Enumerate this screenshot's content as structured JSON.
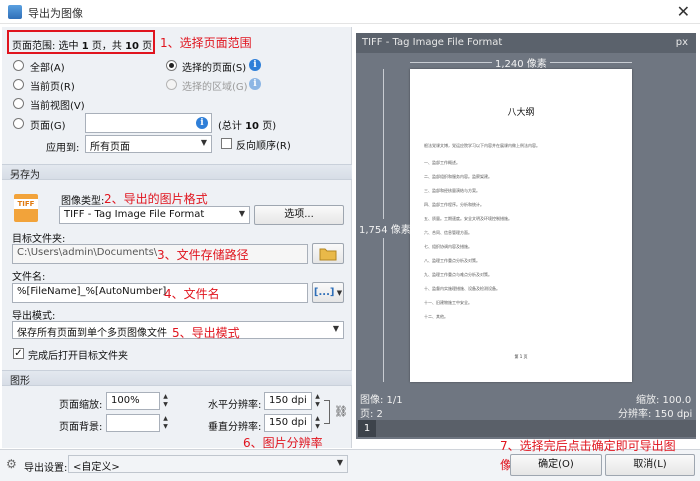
{
  "window": {
    "title": "导出为图像",
    "close": "✕"
  },
  "range": {
    "summary_prefix": "页面范围: 选中 ",
    "selected": "1",
    "mid": " 页，共 ",
    "total": "10",
    "suffix": " 页",
    "all": "全部(A)",
    "current": "当前页(R)",
    "current_view": "当前视图(V)",
    "pages": "页面(G)",
    "selected_pages": "选择的页面(S)",
    "selected_area": "选择的区域(G)",
    "pages_value": "",
    "total_prefix": "(总计 ",
    "total_count": "10",
    "total_suffix": " 页)",
    "apply_to_label": "应用到:",
    "apply_to_value": "所有页面",
    "reverse_order": "反向顺序(R)"
  },
  "save_as": {
    "section": "另存为",
    "tiff_icon_label": "TIFF",
    "image_type_label": "图像类型:",
    "image_type_value": "TIFF - Tag Image File Format",
    "options_button": "选项...",
    "target_folder_label": "目标文件夹:",
    "target_folder_value": "C:\\Users\\admin\\Documents\\",
    "filename_label": "文件名:",
    "filename_value": "%[FileName]_%[AutoNumber]",
    "filename_macro_button": "[...]",
    "export_mode_label": "导出模式:",
    "export_mode_value": "保存所有页面到单个多页图像文件",
    "open_folder_after": "完成后打开目标文件夹"
  },
  "graphics": {
    "section": "图形",
    "page_zoom_label": "页面缩放:",
    "page_zoom_value": "100%",
    "page_bg_label": "页面背景:",
    "h_res_label": "水平分辨率:",
    "h_res_value": "150 dpi",
    "v_res_label": "垂直分辨率:",
    "v_res_value": "150 dpi"
  },
  "preview": {
    "header": "TIFF - Tag Image File Format",
    "unit": "px",
    "width_label": "1,240 像素",
    "height_label": "1,754 像素",
    "doc_title": "八大纲",
    "doc_para": "根法党课文博，党运应院学习以下内容并在展课内做上例法内容。",
    "doc_items": [
      "一、监部工作概述。",
      "二、监部组织和服务内容。监察架建。",
      "三、监部和经核量演结与方案。",
      "四、监部工作程序。分析和统计。",
      "五、质量。工期速度。安全文明及环境控制措施。",
      "六、合同、信息管理方面。",
      "七、组织协调内容及措施。",
      "八、监理工作重点分析及对策。",
      "九、监理工作重点与难点分析及对策。",
      "十、监督内实施理措施、设备及检测设备。",
      "十一、旧建物施工中安全。",
      "十二、其他。"
    ],
    "doc_page_num": "第 1 页",
    "image_info": "图像: 1/1",
    "page_info": "页: 2",
    "zoom_info": "缩放: 100.0",
    "res_info": "分辨率: 150 dpi",
    "page_tab": "1"
  },
  "bottom": {
    "export_settings_label": "导出设置:",
    "export_settings_value": "<自定义>",
    "ok_button": "确定(O)",
    "cancel_button": "取消(L)"
  },
  "annotations": {
    "a1": "1、选择页面范围",
    "a2": "2、导出的图片格式",
    "a3": "3、文件存储路径",
    "a4": "4、文件名",
    "a5": "5、导出模式",
    "a6": "6、图片分辨率",
    "a7_line1": "7、选择完后点击确定即可导出图",
    "a7_line2": "像"
  },
  "colors": {
    "accent": "#2f7fd8",
    "annotation": "#e0141e",
    "preview_bg": "#6f7681"
  }
}
